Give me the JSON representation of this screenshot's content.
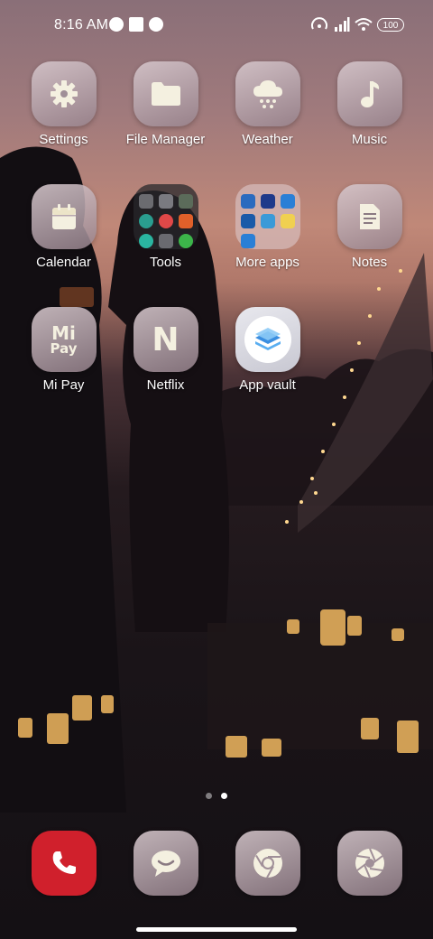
{
  "status_bar": {
    "time": "8:16 AM",
    "battery": "100"
  },
  "apps_row1": [
    {
      "label": "Settings",
      "icon": "gear-icon"
    },
    {
      "label": "File Manager",
      "icon": "folder-icon"
    },
    {
      "label": "Weather",
      "icon": "cloud-snow-icon"
    },
    {
      "label": "Music",
      "icon": "music-note-icon"
    }
  ],
  "apps_row2": [
    {
      "label": "Calendar",
      "icon": "calendar-icon"
    },
    {
      "label": "Tools",
      "icon": "folder-icon"
    },
    {
      "label": "More apps",
      "icon": "folder-icon"
    },
    {
      "label": "Notes",
      "icon": "notes-icon"
    }
  ],
  "apps_row3": [
    {
      "label": "Mi Pay",
      "icon": "mi-pay-icon",
      "logo_line1": "Mi",
      "logo_line2": "Pay"
    },
    {
      "label": "Netflix",
      "icon": "netflix-icon",
      "logo": "N"
    },
    {
      "label": "App vault",
      "icon": "app-vault-icon"
    }
  ],
  "tools_folder_colors": [
    "#6b6b70",
    "#7a7a80",
    "#5b6b5a",
    "#2a9d8f",
    "#e04848",
    "#e0602a",
    "#2ab5a0",
    "#6a6a70",
    "#3cb54a"
  ],
  "more_apps_folder_colors": [
    "#2a6bbf",
    "#1e3a8a",
    "#2a7fd6",
    "#1a5aa8",
    "#3a9ad8",
    "#f0d050",
    "#2a7fd6"
  ],
  "page_indicator": {
    "count": 2,
    "active": 1
  },
  "dock": [
    {
      "name": "phone",
      "icon": "phone-icon"
    },
    {
      "name": "messages",
      "icon": "message-icon"
    },
    {
      "name": "browser",
      "icon": "chrome-icon"
    },
    {
      "name": "camera",
      "icon": "camera-aperture-icon"
    }
  ],
  "colors": {
    "phone_red": "#d0202c",
    "tile_icon": "#f4f0e0"
  }
}
